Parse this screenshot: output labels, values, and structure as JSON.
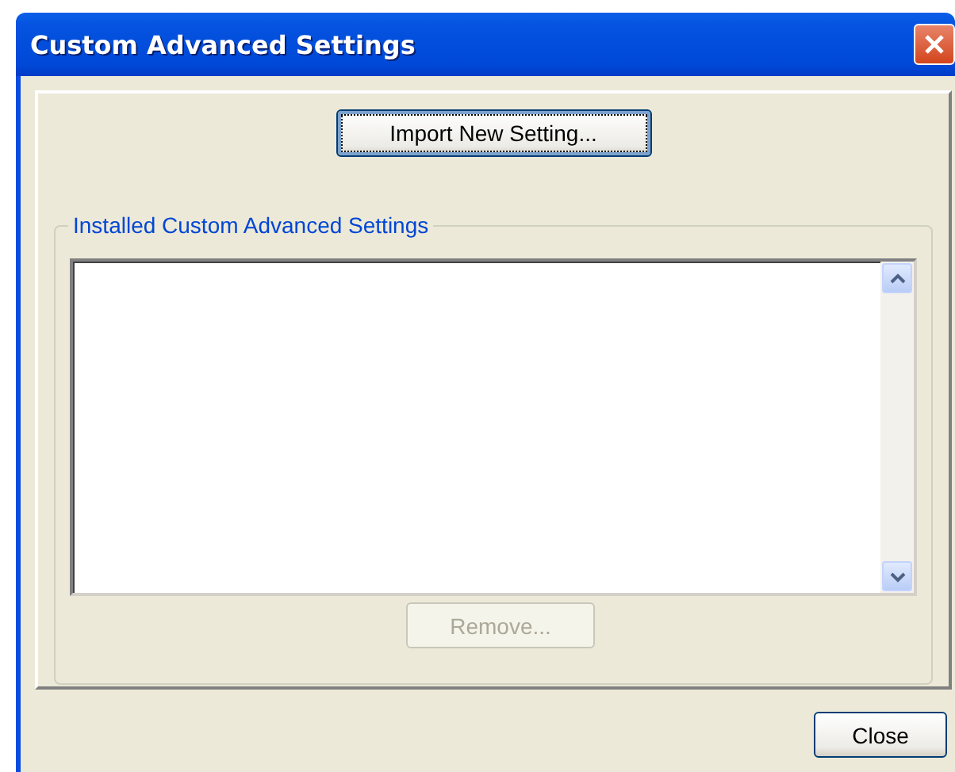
{
  "window": {
    "title": "Custom Advanced Settings"
  },
  "import_button": {
    "label": "Import New Setting...",
    "focused": true
  },
  "group": {
    "title": "Installed Custom Advanced Settings"
  },
  "remove_button": {
    "label": "Remove...",
    "disabled": true
  },
  "close_button": {
    "label": "Close",
    "disabled": false
  }
}
